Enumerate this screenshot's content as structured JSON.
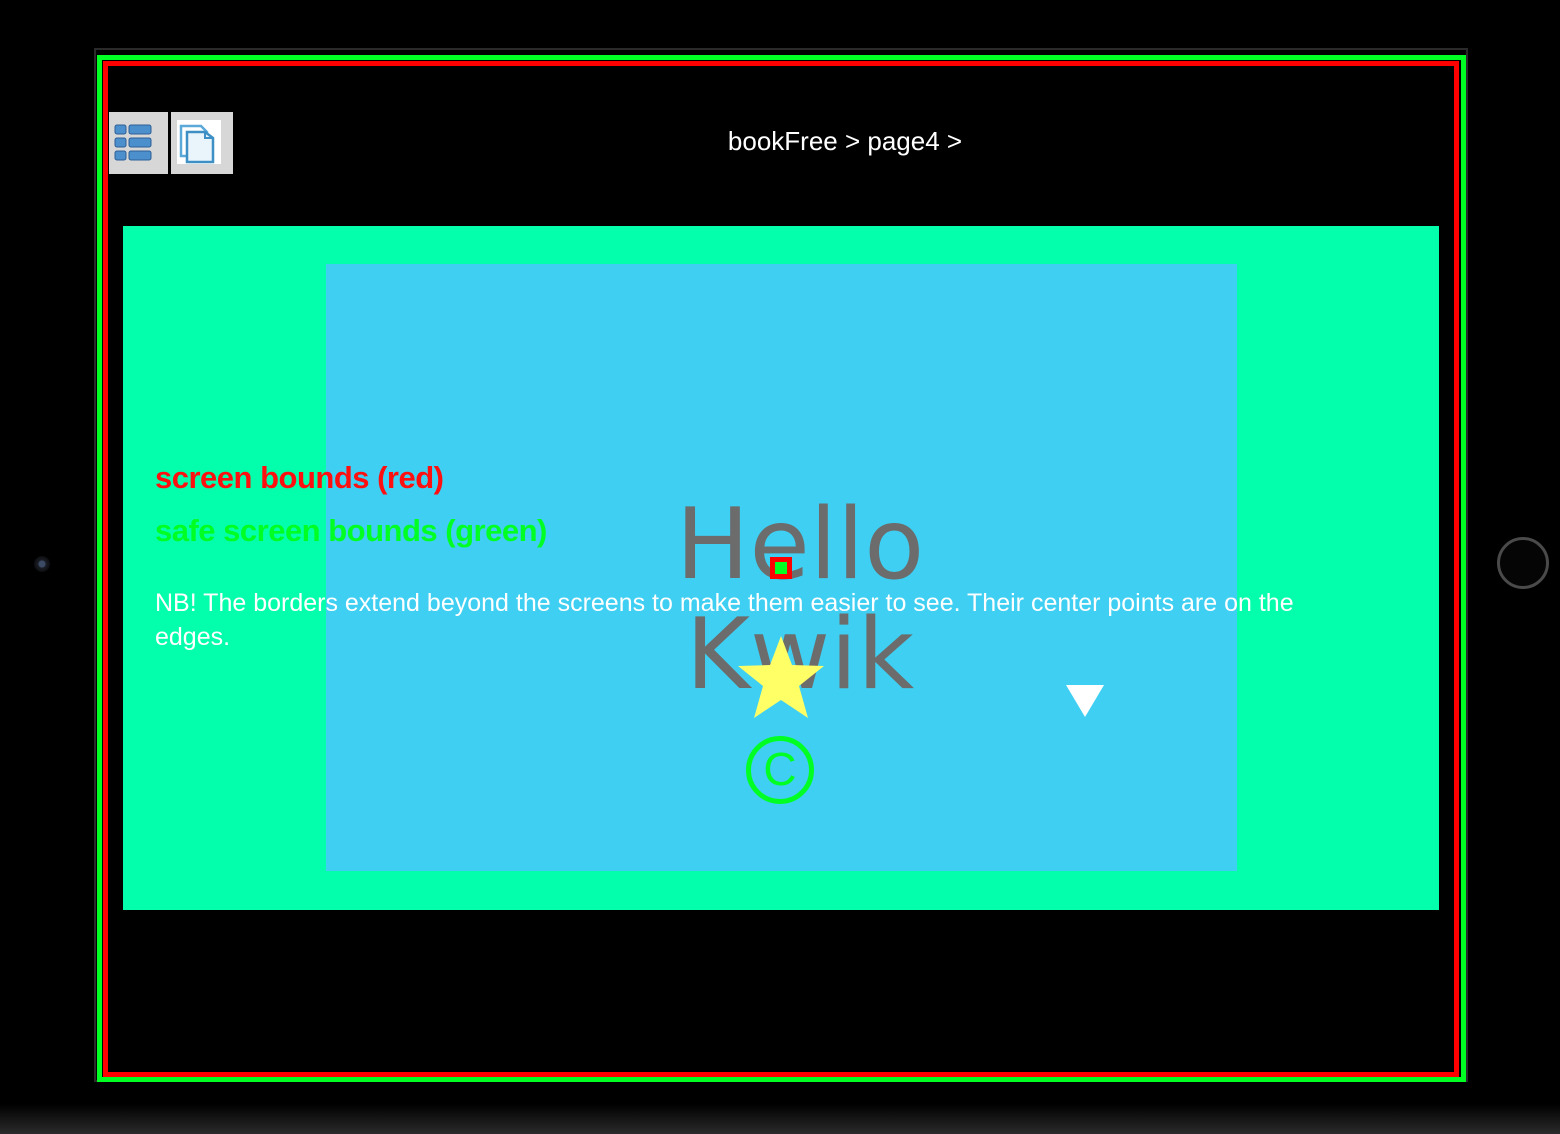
{
  "toolbar": {
    "list_button_icon": "list-icon",
    "page_button_icon": "page-copy-icon"
  },
  "breadcrumb": "bookFree > page4 >",
  "page": {
    "background_color": "#03ffab",
    "panel_color": "#3ecff2",
    "title": "Hello Kwik",
    "screen_bounds_label": "screen bounds (red)",
    "safe_bounds_label": "safe screen bounds (green)",
    "note": "NB! The borders extend beyond the screens to make them easier to see. Their center points are on the edges.",
    "copyright_symbol": "C",
    "star_icon": "star-icon",
    "triangle_icon": "triangle-down-icon"
  },
  "colors": {
    "screen_bounds": "#ff0000",
    "safe_bounds": "#00ff22",
    "star": "#ffff66",
    "title": "#6c6c6c"
  }
}
